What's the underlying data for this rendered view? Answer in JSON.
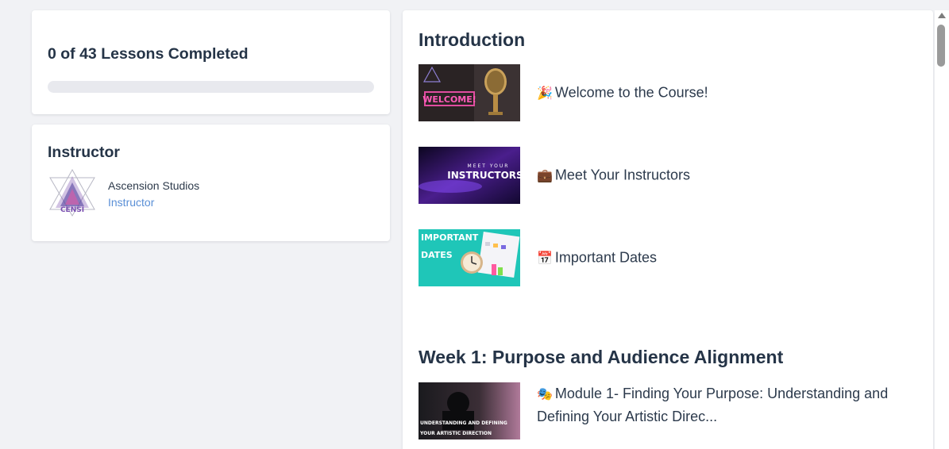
{
  "progress": {
    "title": "0 of 43 Lessons Completed",
    "completed": 0,
    "total": 43,
    "fill_color": "#4c5bd4"
  },
  "instructor": {
    "heading": "Instructor",
    "name": "Ascension Studios",
    "role": "Instructor",
    "avatar_icon": "ascension-logo-icon",
    "role_color": "#5a8fd6"
  },
  "sections": [
    {
      "title": "Introduction",
      "lessons": [
        {
          "emoji": "🎉",
          "title": "Welcome to the Course!",
          "thumb_text": "WELCOME!",
          "thumb_icon": "microphone-icon"
        },
        {
          "emoji": "💼",
          "title": "Meet Your Instructors",
          "thumb_text_top": "MEET YOUR",
          "thumb_text": "INSTRUCTORS"
        },
        {
          "emoji": "📅",
          "title": "Important Dates",
          "thumb_text_top": "IMPORTANT",
          "thumb_text": "DATES",
          "thumb_icon": "clock-calendar-icon"
        }
      ]
    },
    {
      "title": "Week 1: Purpose and Audience Alignment",
      "lessons": [
        {
          "emoji": "🎭",
          "title": "Module 1- Finding Your Purpose: Understanding and Defining Your Artistic Direc...",
          "thumb_text_top": "UNDERSTANDING AND DEFINING",
          "thumb_text": "YOUR ARTISTIC DIRECTION"
        }
      ]
    }
  ]
}
